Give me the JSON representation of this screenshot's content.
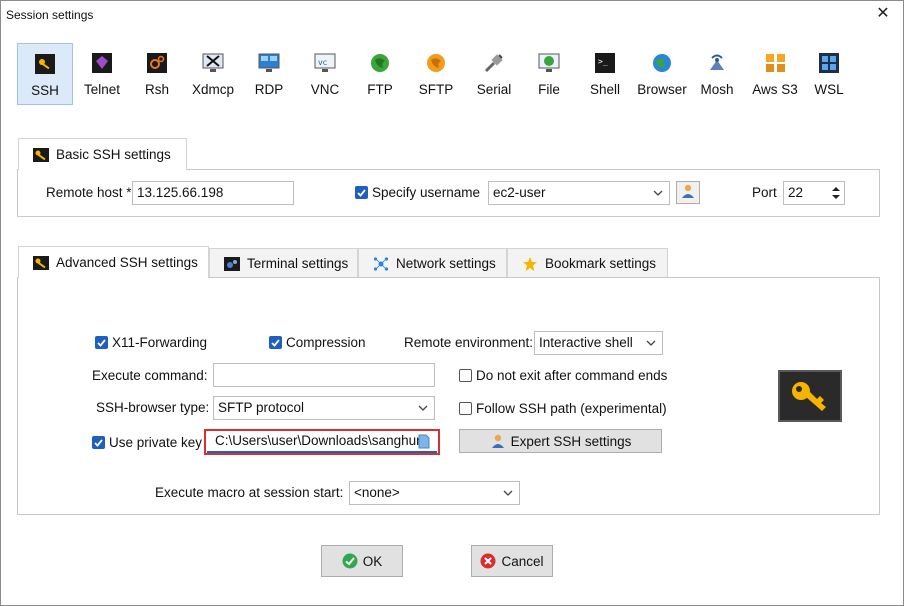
{
  "window": {
    "title": "Session settings",
    "close_glyph": "✕"
  },
  "sessions": [
    {
      "label": "SSH",
      "icon": "ssh-key-icon",
      "active": true
    },
    {
      "label": "Telnet",
      "icon": "telnet-icon"
    },
    {
      "label": "Rsh",
      "icon": "rsh-icon"
    },
    {
      "label": "Xdmcp",
      "icon": "xdmcp-icon"
    },
    {
      "label": "RDP",
      "icon": "rdp-icon"
    },
    {
      "label": "VNC",
      "icon": "vnc-icon"
    },
    {
      "label": "FTP",
      "icon": "ftp-icon"
    },
    {
      "label": "SFTP",
      "icon": "sftp-icon"
    },
    {
      "label": "Serial",
      "icon": "serial-icon"
    },
    {
      "label": "File",
      "icon": "file-icon"
    },
    {
      "label": "Shell",
      "icon": "shell-icon"
    },
    {
      "label": "Browser",
      "icon": "browser-icon"
    },
    {
      "label": "Mosh",
      "icon": "mosh-icon"
    },
    {
      "label": "Aws S3",
      "icon": "aws-s3-icon"
    },
    {
      "label": "WSL",
      "icon": "wsl-icon"
    }
  ],
  "basic": {
    "tab_label": "Basic SSH settings",
    "remote_host_label": "Remote host *",
    "remote_host_value": "13.125.66.198",
    "specify_username_label": "Specify username",
    "specify_username_checked": true,
    "username_value": "ec2-user",
    "port_label": "Port",
    "port_value": "22"
  },
  "tabs": [
    {
      "label": "Advanced SSH settings",
      "icon": "key-icon",
      "active": true
    },
    {
      "label": "Terminal settings",
      "icon": "terminal-icon"
    },
    {
      "label": "Network settings",
      "icon": "network-icon"
    },
    {
      "label": "Bookmark settings",
      "icon": "star-icon"
    }
  ],
  "advanced": {
    "x11_label": "X11-Forwarding",
    "x11_checked": true,
    "compression_label": "Compression",
    "compression_checked": true,
    "remote_env_label": "Remote environment:",
    "remote_env_value": "Interactive shell",
    "exec_cmd_label": "Execute command:",
    "exec_cmd_value": "",
    "no_exit_label": "Do not exit after command ends",
    "no_exit_checked": false,
    "browser_type_label": "SSH-browser type:",
    "browser_type_value": "SFTP protocol",
    "follow_path_label": "Follow SSH path (experimental)",
    "follow_path_checked": false,
    "private_key_label": "Use private key",
    "private_key_checked": true,
    "private_key_value": "C:\\Users\\user\\Downloads\\sanghun",
    "expert_button": "Expert SSH settings",
    "macro_label": "Execute macro at session start:",
    "macro_value": "<none>"
  },
  "footer": {
    "ok_label": "OK",
    "cancel_label": "Cancel"
  },
  "colors": {
    "accent": "#1f5fbf",
    "highlight": "#d9302c",
    "ok_green": "#2fa84f",
    "cancel_red": "#d9302c",
    "key_gold": "#f5b400"
  }
}
